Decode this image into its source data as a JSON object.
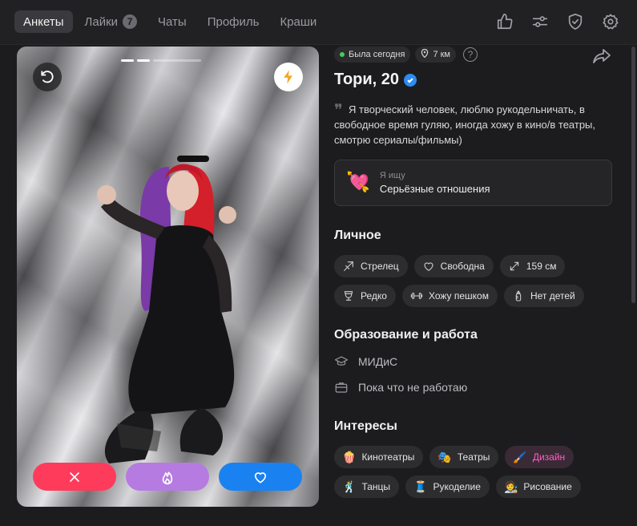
{
  "nav": {
    "tabs": [
      {
        "label": "Анкеты",
        "active": true
      },
      {
        "label": "Лайки",
        "count": "7"
      },
      {
        "label": "Чаты"
      },
      {
        "label": "Профиль"
      },
      {
        "label": "Краши"
      }
    ],
    "icons": [
      "thumbs-up-icon",
      "sliders-icon",
      "shield-check-icon",
      "gear-icon"
    ]
  },
  "photo": {
    "icons": [
      "undo-icon",
      "lightning-icon"
    ],
    "actions": [
      "close-icon",
      "flame-icon",
      "heart-icon"
    ]
  },
  "profile": {
    "last_seen": "Была сегодня",
    "distance": "7 км",
    "help": "?",
    "name": "Тори, 20",
    "about": "Я творческий человек, люблю рукодельничать, в свободное время гуляю, иногда хожу в кино/в театры, смотрю сериалы/фильмы)",
    "looking_for": {
      "label": "Я ищу",
      "value": "Серьёзные отношения",
      "emoji": "💘"
    }
  },
  "personal": {
    "title": "Личное",
    "chips": [
      {
        "icon": "zodiac-arrow-icon",
        "label": "Стрелец"
      },
      {
        "icon": "heart-outline-icon",
        "label": "Свободна"
      },
      {
        "icon": "height-arrows-icon",
        "label": "159 см"
      },
      {
        "icon": "wine-glass-icon",
        "label": "Редко"
      },
      {
        "icon": "dumbbell-icon",
        "label": "Хожу пешком"
      },
      {
        "icon": "baby-bottle-icon",
        "label": "Нет детей"
      }
    ]
  },
  "education": {
    "title": "Образование и работа",
    "items": [
      {
        "icon": "graduation-cap-icon",
        "label": "МИДиС"
      },
      {
        "icon": "briefcase-icon",
        "label": "Пока что не работаю"
      }
    ]
  },
  "interests": {
    "title": "Интересы",
    "chips": [
      {
        "emoji": "🍿",
        "label": "Кинотеатры"
      },
      {
        "emoji": "🎭",
        "label": "Театры"
      },
      {
        "emoji": "🖌️",
        "label": "Дизайн",
        "highlight": true
      },
      {
        "emoji": "🕺",
        "label": "Танцы"
      },
      {
        "emoji": "🧵",
        "label": "Рукоделие"
      },
      {
        "emoji": "🧑‍🎨",
        "label": "Рисование"
      }
    ]
  },
  "colors": {
    "background": "#1c1c1e",
    "chip": "#2d2d30",
    "dislike": "#ff3b5c",
    "superlike": "#b57be0",
    "like": "#1a82f0",
    "online": "#3ed15b",
    "verified": "#2d8cf0",
    "highlight_text": "#ff5ec4"
  }
}
